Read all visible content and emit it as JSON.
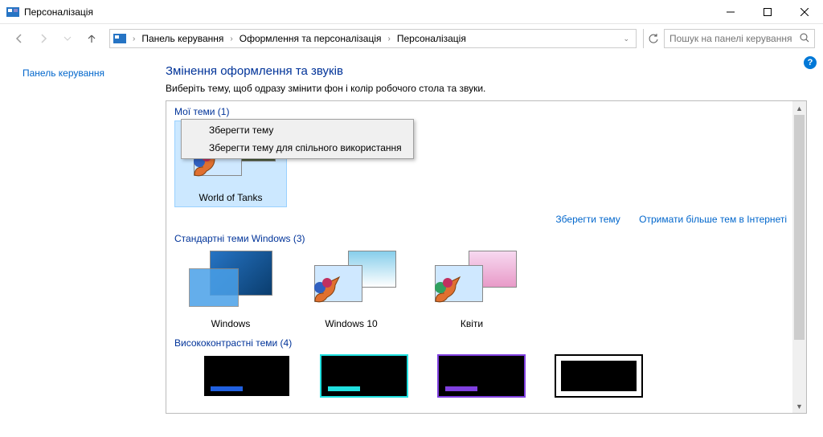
{
  "window": {
    "title": "Персоналізація"
  },
  "breadcrumb": {
    "items": [
      "Панель керування",
      "Оформлення та персоналізація",
      "Персоналізація"
    ]
  },
  "search": {
    "placeholder": "Пошук на панелі керування"
  },
  "sidebar": {
    "home": "Панель керування"
  },
  "page": {
    "heading": "Змінення оформлення та звуків",
    "subtitle": "Виберіть тему, щоб одразу змінити фон і колір робочого стола та звуки."
  },
  "groups": {
    "my": {
      "title": "Мої теми (1)",
      "items": [
        {
          "label": "World of Tanks"
        }
      ]
    },
    "standard": {
      "title": "Стандартні теми Windows (3)",
      "items": [
        {
          "label": "Windows"
        },
        {
          "label": "Windows 10"
        },
        {
          "label": "Квіти"
        }
      ]
    },
    "hc": {
      "title": "Висококонтрастні теми (4)"
    }
  },
  "links": {
    "save": "Зберегти тему",
    "more": "Отримати більше тем в Інтернеті"
  },
  "context_menu": {
    "save": "Зберегти тему",
    "save_share": "Зберегти тему для спільного використання"
  }
}
